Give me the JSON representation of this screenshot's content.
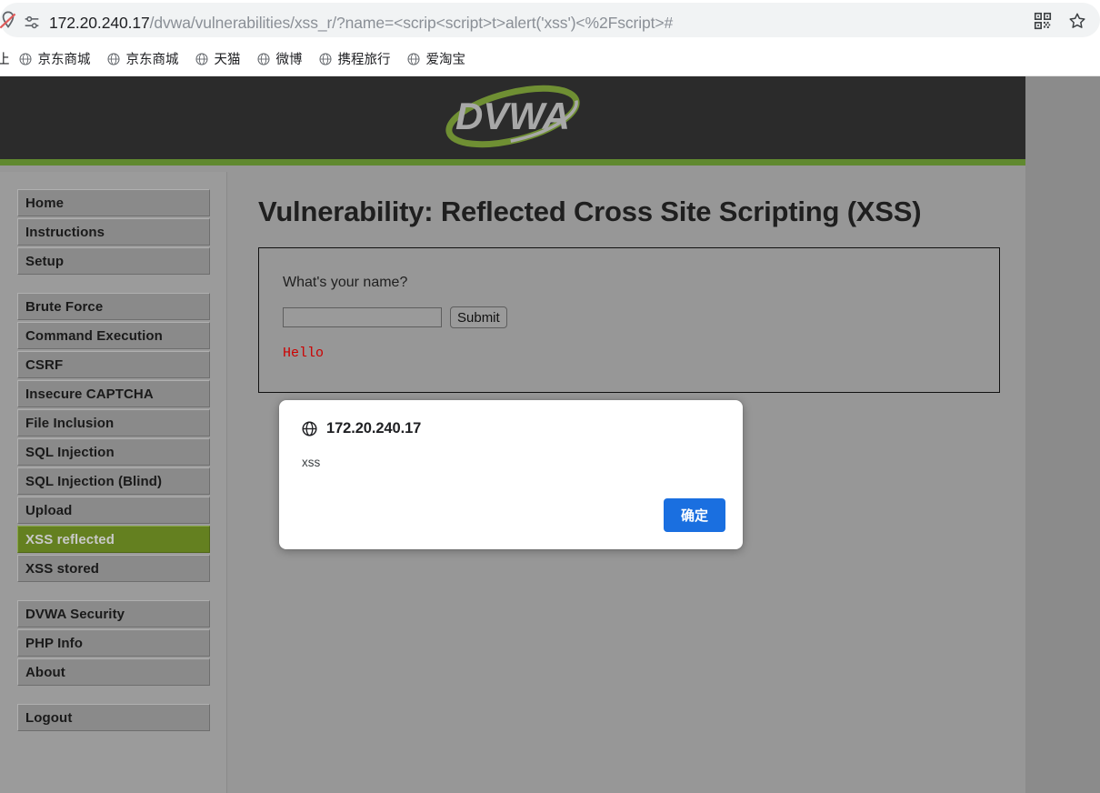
{
  "browser": {
    "url_host": "172.20.240.17",
    "url_path": "/dvwa/vulnerabilities/xss_r/?name=<scrip<script>t>alert('xss')<%2Fscript>#",
    "icons": {
      "blocked_permission": "location-blocked-icon",
      "tune": "tune-icon",
      "qr": "qr-code-icon",
      "star": "bookmark-star-icon"
    },
    "bookmarks": {
      "clipped_label": "止",
      "items": [
        {
          "label": "京东商城",
          "icon": "globe-icon"
        },
        {
          "label": "京东商城",
          "icon": "globe-icon"
        },
        {
          "label": "天猫",
          "icon": "globe-icon"
        },
        {
          "label": "微博",
          "icon": "globe-icon"
        },
        {
          "label": "携程旅行",
          "icon": "globe-icon"
        },
        {
          "label": "爱淘宝",
          "icon": "globe-icon"
        }
      ]
    }
  },
  "site": {
    "logo_text": "DVWA",
    "colors": {
      "header_bg": "#2b2b2b",
      "accent_green": "#60892f",
      "page_bg": "#979797",
      "outer_bg": "#8b8b8b",
      "active_menu": "#648020",
      "hello_red": "#cc0000",
      "dialog_blue": "#1a6fe0"
    }
  },
  "sidebar": {
    "groups": [
      {
        "items": [
          {
            "label": "Home",
            "active": false
          },
          {
            "label": "Instructions",
            "active": false
          },
          {
            "label": "Setup",
            "active": false
          }
        ]
      },
      {
        "items": [
          {
            "label": "Brute Force",
            "active": false
          },
          {
            "label": "Command Execution",
            "active": false
          },
          {
            "label": "CSRF",
            "active": false
          },
          {
            "label": "Insecure CAPTCHA",
            "active": false
          },
          {
            "label": "File Inclusion",
            "active": false
          },
          {
            "label": "SQL Injection",
            "active": false
          },
          {
            "label": "SQL Injection (Blind)",
            "active": false
          },
          {
            "label": "Upload",
            "active": false
          },
          {
            "label": "XSS reflected",
            "active": true
          },
          {
            "label": "XSS stored",
            "active": false
          }
        ]
      },
      {
        "items": [
          {
            "label": "DVWA Security",
            "active": false
          },
          {
            "label": "PHP Info",
            "active": false
          },
          {
            "label": "About",
            "active": false
          }
        ]
      },
      {
        "items": [
          {
            "label": "Logout",
            "active": false
          }
        ]
      }
    ]
  },
  "main": {
    "title": "Vulnerability: Reflected Cross Site Scripting (XSS)",
    "form": {
      "question": "What's your name?",
      "input_value": "",
      "input_placeholder": "",
      "submit_label": "Submit"
    },
    "result_text": "Hello"
  },
  "dialog": {
    "origin": "172.20.240.17",
    "message": "xss",
    "ok_label": "确定",
    "icon": "globe-icon"
  }
}
